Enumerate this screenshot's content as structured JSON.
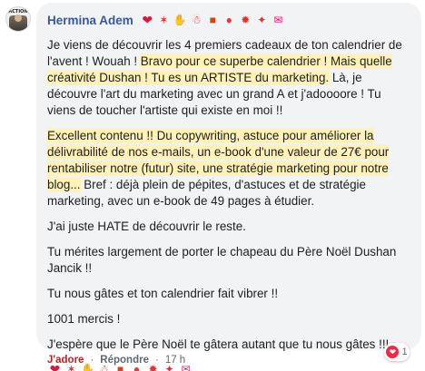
{
  "comment": {
    "author": "Hermina Adem",
    "avatar_label": "ACTION",
    "header_emojis": [
      "heart-emoji",
      "party-emoji",
      "pray-emoji",
      "santa-emoji",
      "gift-emoji",
      "balloon-emoji",
      "confetti-emoji",
      "party-popper-emoji",
      "love-letter-emoji"
    ],
    "paragraphs": [
      {
        "parts": [
          "Je viens de découvrir les 4 premiers cadeaux de ton calendrier de l'avent ! Wouah ! ",
          "Bravo pour ce superbe calendrier ! Mais quelle créativité Dushan ! Tu es un ARTISTE du marketing.",
          " Là, je découvre l'art du marketing avec un grand A et j'adoooore ! Tu viens de toucher l'artiste qui existe en moi !!"
        ]
      },
      {
        "parts": [
          "Excellent contenu !! Du copywriting, astuce pour améliorer la délivrabilité de nos e-mails, un e-book d'une valeur de 27€ pour rentabiliser notre (futur) site, une stratégie marketing pour notre blog...",
          " Bref : déjà plein de pépites, d'astuces et de stratégie marketing, avec un e-book de 49 pages à étudier."
        ]
      },
      {
        "text": "J'ai juste HATE de découvrir le reste."
      },
      {
        "text": "Tu mérites largement de porter le chapeau du Père Noël Dushan Jancik !!"
      },
      {
        "text": "Tu nous gâtes et ton calendrier fait vibrer !!"
      },
      {
        "text": "1001 mercis !"
      },
      {
        "text": "J'espère que le Père Noël te gâtera autant que tu nous gâtes !!!"
      }
    ],
    "bottom_emojis": [
      "heart-emoji",
      "party-emoji",
      "pray-emoji",
      "santa-emoji",
      "gift-emoji",
      "balloon-emoji",
      "confetti-emoji",
      "party-popper-emoji",
      "love-letter-emoji"
    ],
    "reaction_count": "1"
  },
  "footer": {
    "like_label": "J'adore",
    "separator": "·",
    "reply_label": "Répondre",
    "time": "17 h"
  },
  "colors": {
    "author": "#385898",
    "bubble": "#f2f3f5",
    "highlight": "#fff2b8",
    "like": "#b22222"
  }
}
